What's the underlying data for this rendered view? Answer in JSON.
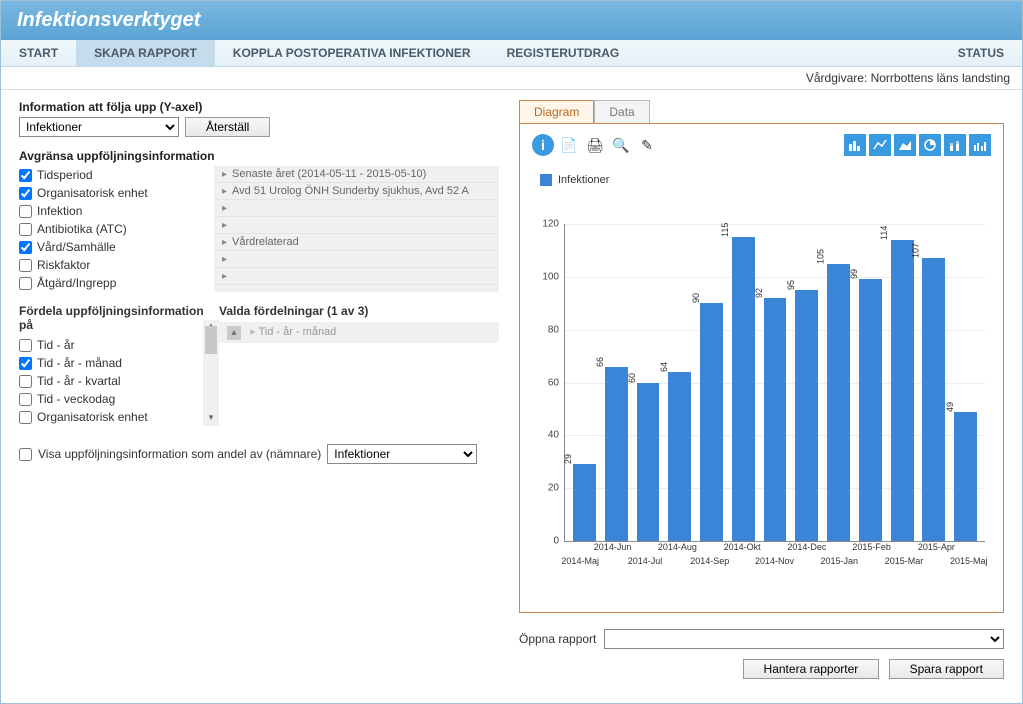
{
  "app_title": "Infektionsverktyget",
  "menu": {
    "items": [
      "START",
      "SKAPA RAPPORT",
      "KOPPLA POSTOPERATIVA INFEKTIONER",
      "REGISTERUTDRAG"
    ],
    "right": "STATUS",
    "active_index": 1
  },
  "provider": "Vårdgivare: Norrbottens läns landsting",
  "yaxis": {
    "title": "Information att följa upp (Y-axel)",
    "selected": "Infektioner",
    "reset": "Återställ"
  },
  "filters": {
    "title": "Avgränsa uppföljningsinformation",
    "items": [
      {
        "label": "Tidsperiod",
        "checked": true,
        "value": "Senaste året (2014-05-11 - 2015-05-10)"
      },
      {
        "label": "Organisatorisk enhet",
        "checked": true,
        "value": "Avd 51 Urolog ÖNH Sunderby sjukhus, Avd 52 A"
      },
      {
        "label": "Infektion",
        "checked": false,
        "value": ""
      },
      {
        "label": "Antibiotika (ATC)",
        "checked": false,
        "value": ""
      },
      {
        "label": "Vård/Samhälle",
        "checked": true,
        "value": "Vårdrelaterad"
      },
      {
        "label": "Riskfaktor",
        "checked": false,
        "value": ""
      },
      {
        "label": "Åtgärd/Ingrepp",
        "checked": false,
        "value": ""
      }
    ]
  },
  "distrib": {
    "title_left": "Fördela uppföljningsinformation på",
    "title_right": "Valda fördelningar (1 av 3)",
    "options": [
      {
        "label": "Tid - år",
        "checked": false
      },
      {
        "label": "Tid - år - månad",
        "checked": true
      },
      {
        "label": "Tid - år - kvartal",
        "checked": false
      },
      {
        "label": "Tid - veckodag",
        "checked": false
      },
      {
        "label": "Organisatorisk enhet",
        "checked": false
      }
    ],
    "selected_value": "Tid - år - månad"
  },
  "ratio": {
    "label": "Visa uppföljningsinformation som andel av (nämnare)",
    "selected": "Infektioner"
  },
  "tabs": {
    "diagram": "Diagram",
    "data": "Data"
  },
  "chart_data": {
    "type": "bar",
    "legend": "Infektioner",
    "ylim": [
      0,
      120
    ],
    "yticks": [
      0,
      20,
      40,
      60,
      80,
      100,
      120
    ],
    "categories": [
      "2014-Maj",
      "2014-Jun",
      "2014-Jul",
      "2014-Aug",
      "2014-Sep",
      "2014-Okt",
      "2014-Nov",
      "2014-Dec",
      "2015-Jan",
      "2015-Feb",
      "2015-Mar",
      "2015-Apr",
      "2015-Maj"
    ],
    "values": [
      29,
      66,
      60,
      64,
      90,
      115,
      92,
      95,
      105,
      99,
      114,
      107,
      49
    ]
  },
  "bottom": {
    "open_label": "Öppna rapport",
    "manage": "Hantera rapporter",
    "save": "Spara rapport"
  }
}
